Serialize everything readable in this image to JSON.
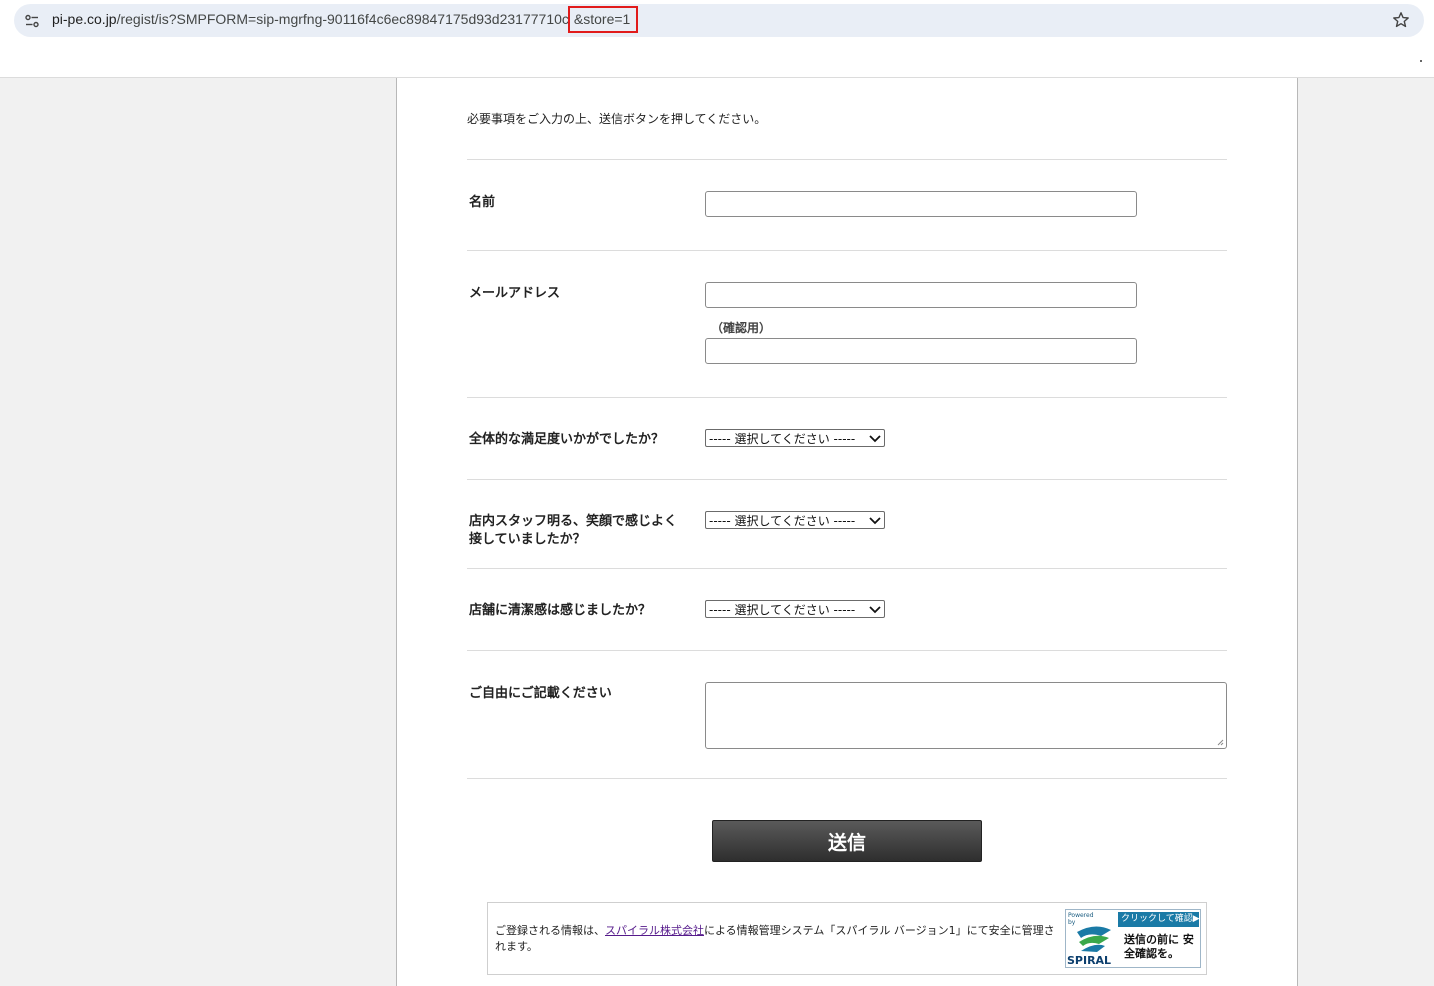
{
  "browser": {
    "url_host": "pi-pe.co.jp",
    "url_path": "/regist/is?SMPFORM=sip-mgrfng-90116f4c6ec89847175d93d23177710c",
    "url_highlight": "&store=1"
  },
  "form": {
    "intro": "必要事項をご入力の上、送信ボタンを押してください。",
    "name_label": "名前",
    "email_label": "メールアドレス",
    "email_confirm_label": "（確認用）",
    "q1_label": "全体的な満足度いかがでしたか？",
    "q1_value": "----- 選択してください -----",
    "q2_label": "店内スタッフ明る、笑顔で感じよく接していましたか？",
    "q2_value": "----- 選択してください -----",
    "q3_label": "店舗に清潔感は感じましたか？",
    "q3_value": "----- 選択してください -----",
    "comment_label": "ご自由にご記載ください",
    "submit_label": "送信"
  },
  "footer": {
    "text_before": "ご登録される情報は、",
    "link_text": "スパイラル株式会社",
    "text_after": "による情報管理システム「スパイラル バージョン1」にて安全に管理されます。",
    "badge_powered": "Powered by",
    "badge_top": "クリックして確認▶",
    "badge_logo": "SPIRAL",
    "badge_msg": "送信の前に 安全確認を。"
  },
  "colors": {
    "highlight_box": "#e11b1b",
    "omnibox_bg": "#e9eef6",
    "submit_bg": "#3a3a3a",
    "link": "#551a8b"
  }
}
